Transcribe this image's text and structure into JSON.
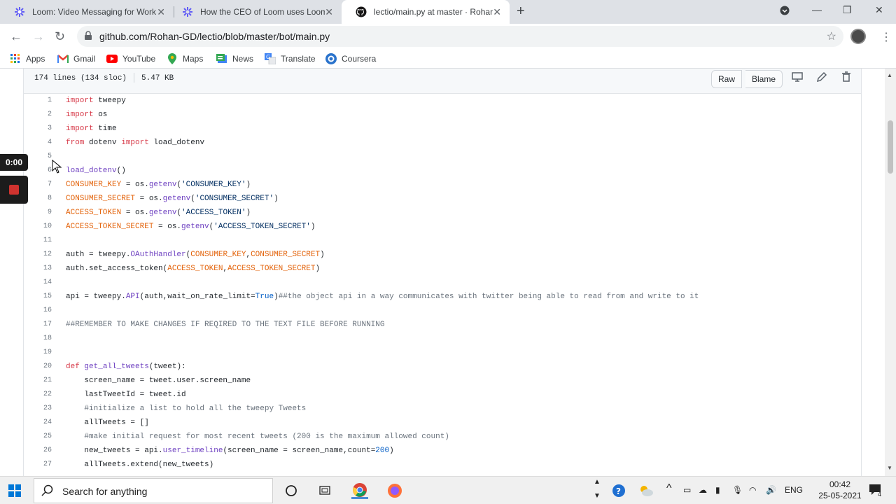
{
  "browser": {
    "tabs": [
      {
        "title": "Loom: Video Messaging for Work"
      },
      {
        "title": "How the CEO of Loom uses Loom"
      },
      {
        "title": "lectio/main.py at master · Rohan-GD"
      }
    ],
    "url": "github.com/Rohan-GD/lectio/blob/master/bot/main.py",
    "bookmarks": [
      {
        "label": "Apps"
      },
      {
        "label": "Gmail"
      },
      {
        "label": "YouTube"
      },
      {
        "label": "Maps"
      },
      {
        "label": "News"
      },
      {
        "label": "Translate"
      },
      {
        "label": "Coursera"
      }
    ]
  },
  "file": {
    "lines_info": "174 lines (134 sloc)",
    "size": "5.47 KB",
    "raw_label": "Raw",
    "blame_label": "Blame"
  },
  "code_lines": [
    {
      "n": "1",
      "t": "import tweepy"
    },
    {
      "n": "2",
      "t": "import os"
    },
    {
      "n": "3",
      "t": "import time"
    },
    {
      "n": "4",
      "t": "from dotenv import load_dotenv"
    },
    {
      "n": "5",
      "t": ""
    },
    {
      "n": "6",
      "t": "load_dotenv()"
    },
    {
      "n": "7",
      "t": "CONSUMER_KEY = os.getenv('CONSUMER_KEY')"
    },
    {
      "n": "8",
      "t": "CONSUMER_SECRET = os.getenv('CONSUMER_SECRET')"
    },
    {
      "n": "9",
      "t": "ACCESS_TOKEN = os.getenv('ACCESS_TOKEN')"
    },
    {
      "n": "10",
      "t": "ACCESS_TOKEN_SECRET = os.getenv('ACCESS_TOKEN_SECRET')"
    },
    {
      "n": "11",
      "t": ""
    },
    {
      "n": "12",
      "t": "auth = tweepy.OAuthHandler(CONSUMER_KEY,CONSUMER_SECRET)"
    },
    {
      "n": "13",
      "t": "auth.set_access_token(ACCESS_TOKEN,ACCESS_TOKEN_SECRET)"
    },
    {
      "n": "14",
      "t": ""
    },
    {
      "n": "15",
      "t": "api = tweepy.API(auth,wait_on_rate_limit=True)##the object api in a way communicates with twitter being able to read from and write to it"
    },
    {
      "n": "16",
      "t": ""
    },
    {
      "n": "17",
      "t": "##REMEMBER TO MAKE CHANGES IF REQIRED TO THE TEXT FILE BEFORE RUNNING"
    },
    {
      "n": "18",
      "t": ""
    },
    {
      "n": "19",
      "t": ""
    },
    {
      "n": "20",
      "t": "def get_all_tweets(tweet):"
    },
    {
      "n": "21",
      "t": "    screen_name = tweet.user.screen_name"
    },
    {
      "n": "22",
      "t": "    lastTweetId = tweet.id"
    },
    {
      "n": "23",
      "t": "    #initialize a list to hold all the tweepy Tweets"
    },
    {
      "n": "24",
      "t": "    allTweets = []"
    },
    {
      "n": "25",
      "t": "    #make initial request for most recent tweets (200 is the maximum allowed count)"
    },
    {
      "n": "26",
      "t": "    new_tweets = api.user_timeline(screen_name = screen_name,count=200)"
    },
    {
      "n": "27",
      "t": "    allTweets.extend(new_tweets)"
    }
  ],
  "loom": {
    "timer": "0:00"
  },
  "taskbar": {
    "search_placeholder": "Search for anything",
    "lang": "ENG",
    "time": "00:42",
    "date": "25-05-2021",
    "notif_count": "4"
  }
}
